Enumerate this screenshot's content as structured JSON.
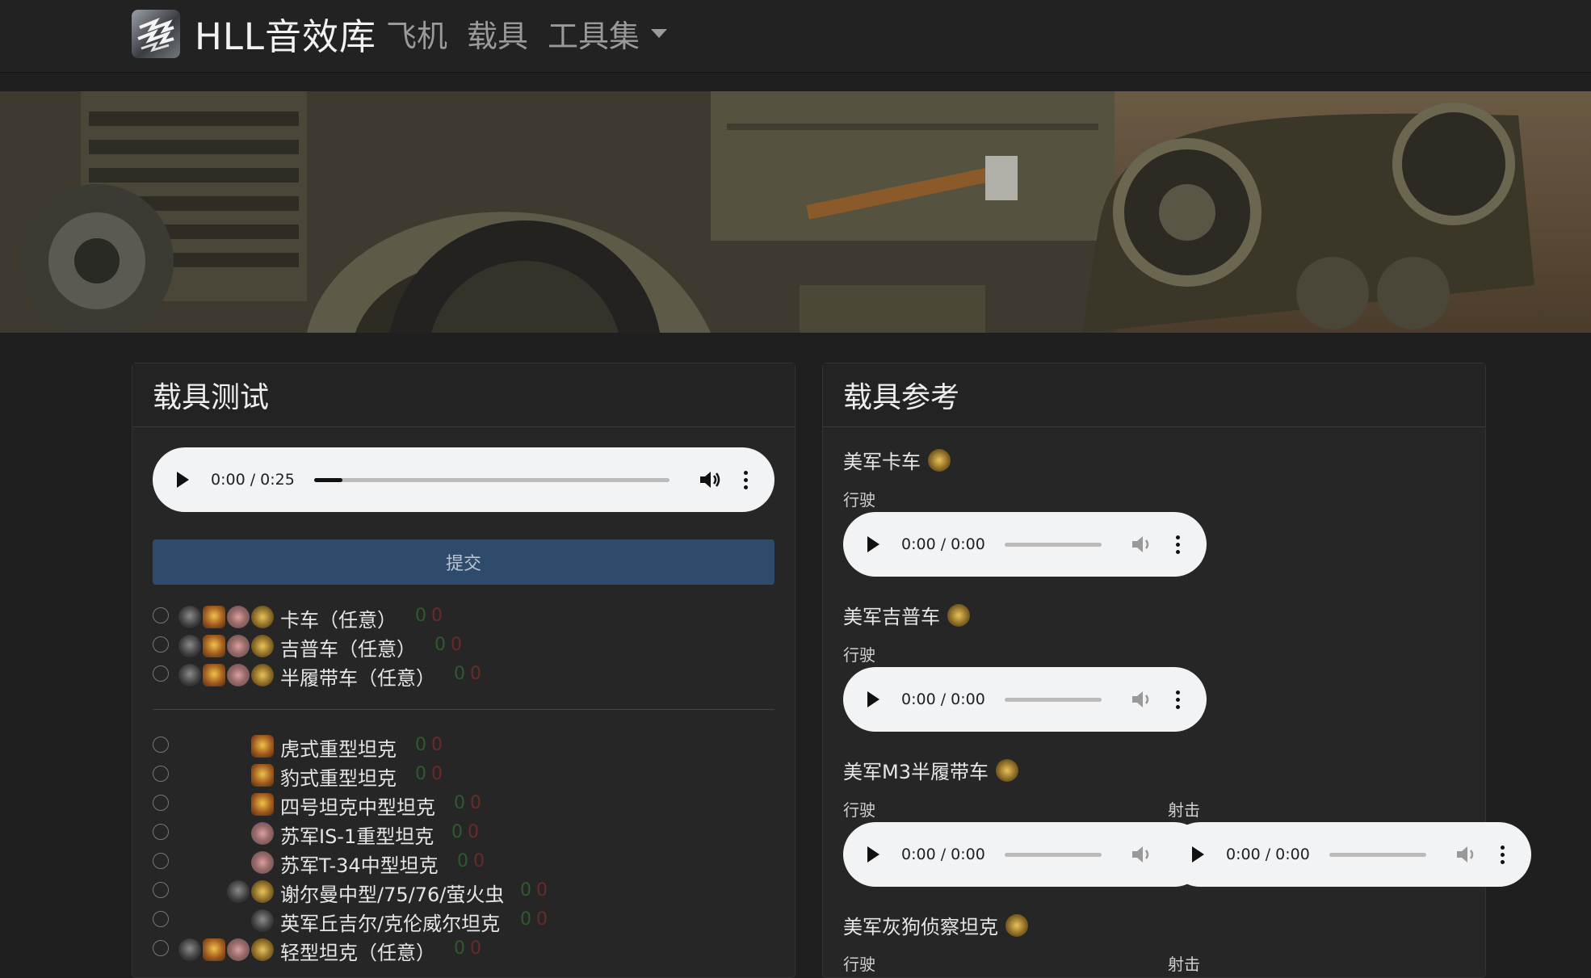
{
  "nav": {
    "brand": "HLL音效库",
    "items": [
      "飞机",
      "载具",
      "工具集"
    ]
  },
  "left_panel": {
    "title": "载具测试",
    "audio": {
      "time": "0:00 / 0:25",
      "progress": 0.08
    },
    "submit_label": "提交",
    "group1": [
      {
        "label": "卡车（任意）",
        "count_a": "0",
        "count_b": "0"
      },
      {
        "label": "吉普车（任意）",
        "count_a": "0",
        "count_b": "0"
      },
      {
        "label": "半履带车（任意）",
        "count_a": "0",
        "count_b": "0"
      }
    ],
    "group2": [
      {
        "label": "虎式重型坦克",
        "count_a": "0",
        "count_b": "0"
      },
      {
        "label": "豹式重型坦克",
        "count_a": "0",
        "count_b": "0"
      },
      {
        "label": "四号坦克中型坦克",
        "count_a": "0",
        "count_b": "0"
      },
      {
        "label": "苏军IS-1重型坦克",
        "count_a": "0",
        "count_b": "0"
      },
      {
        "label": "苏军T-34中型坦克",
        "count_a": "0",
        "count_b": "0"
      },
      {
        "label": "谢尔曼中型/75/76/萤火虫",
        "count_a": "0",
        "count_b": "0"
      },
      {
        "label": "英军丘吉尔/克伦威尔坦克",
        "count_a": "0",
        "count_b": "0"
      },
      {
        "label": "轻型坦克（任意）",
        "count_a": "0",
        "count_b": "0"
      }
    ]
  },
  "right_panel": {
    "title": "载具参考",
    "entries": [
      {
        "name": "美军卡车",
        "sub1": "行驶",
        "time1": "0:00 / 0:00"
      },
      {
        "name": "美军吉普车",
        "sub1": "行驶",
        "time1": "0:00 / 0:00"
      },
      {
        "name": "美军M3半履带车",
        "sub1": "行驶",
        "time1": "0:00 / 0:00",
        "sub2": "射击",
        "time2": "0:00 / 0:00"
      },
      {
        "name": "美军灰狗侦察坦克",
        "sub1": "行驶",
        "sub2": "射击"
      }
    ]
  },
  "colors": {
    "navbar": "#222222",
    "body": "#1f1f1f",
    "submit": "#2f4b6b"
  }
}
